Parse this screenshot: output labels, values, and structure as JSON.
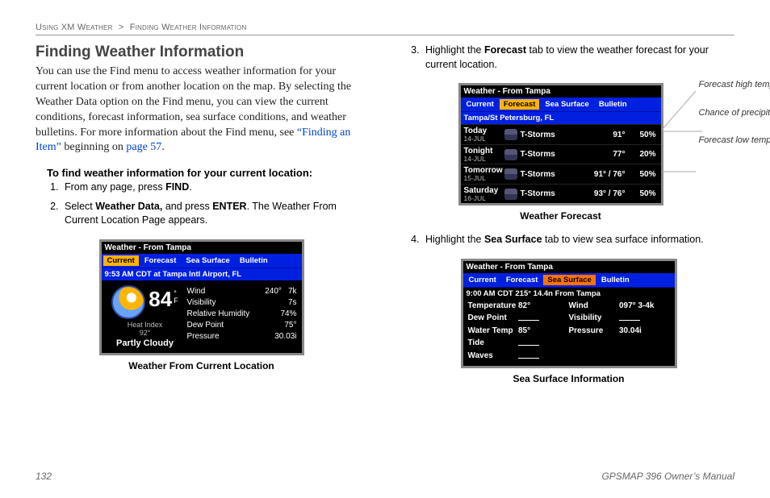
{
  "breadcrumb": {
    "section": "Using XM Weather",
    "sub": "Finding Weather Information"
  },
  "h1": "Finding Weather Information",
  "intro": {
    "text": "You can use the Find menu to access weather information for your current location or from another location on the map. By selecting the Weather Data option on the Find menu, you can view the current conditions, forecast information, sea surface conditions, and weather bulletins. For more information about the Find menu, see ",
    "link1": "“Finding an Item”",
    "mid": " beginning on ",
    "link2": "page 57",
    "end": "."
  },
  "sub_heading": "To find weather information for your current location:",
  "step1": {
    "a": "From any page, press ",
    "b": "FIND",
    "c": "."
  },
  "step2": {
    "a": "Select ",
    "b": "Weather Data,",
    "c": " and press ",
    "d": "ENTER",
    "e": ". The Weather From Current Location Page appears."
  },
  "step3": {
    "a": "Highlight the ",
    "b": "Forecast",
    "c": " tab to view the weather forecast for your current location."
  },
  "step4": {
    "a": "Highlight the ",
    "b": "Sea Surface",
    "c": " tab to view sea surface information."
  },
  "captions": {
    "current": "Weather From Current Location",
    "forecast": "Weather Forecast",
    "sea": "Sea Surface Information"
  },
  "callouts": {
    "hi": "Forecast high temperature",
    "precip": "Chance of precipitation",
    "lo": "Forecast low temperature"
  },
  "device_current": {
    "title": "Weather - From Tampa",
    "tabs": [
      "Current",
      "Forecast",
      "Sea Surface",
      "Bulletin"
    ],
    "active": 0,
    "subbar": "9:53 AM CDT at Tampa Intl Airport, FL",
    "temp": "84",
    "temp_unit_top": "°",
    "temp_unit_bot": "F",
    "heat_index_label": "Heat Index",
    "heat_index": "92°",
    "condition": "Partly Cloudy",
    "rows": [
      {
        "label": "Wind",
        "v1": "240°",
        "v2": "7k"
      },
      {
        "label": "Visibility",
        "v1": "",
        "v2": "7s"
      },
      {
        "label": "Relative Humidity",
        "v1": "",
        "v2": "74%"
      },
      {
        "label": "Dew Point",
        "v1": "",
        "v2": "75°"
      },
      {
        "label": "Pressure",
        "v1": "",
        "v2": "30.03i"
      }
    ]
  },
  "device_forecast": {
    "title": "Weather - From Tampa",
    "tabs": [
      "Current",
      "Forecast",
      "Sea Surface",
      "Bulletin"
    ],
    "active": 1,
    "subbar": "Tampa/St Petersburg, FL",
    "rows": [
      {
        "day": "Today",
        "date": "14-JUL",
        "cond": "T-Storms",
        "temp": "91°",
        "prec": "50%"
      },
      {
        "day": "Tonight",
        "date": "14-JUL",
        "cond": "T-Storms",
        "temp": "77°",
        "prec": "20%"
      },
      {
        "day": "Tomorrow",
        "date": "15-JUL",
        "cond": "T-Storms",
        "temp": "91° / 76°",
        "prec": "50%"
      },
      {
        "day": "Saturday",
        "date": "16-JUL",
        "cond": "T-Storms",
        "temp": "93° / 76°",
        "prec": "50%"
      }
    ]
  },
  "device_sea": {
    "title": "Weather - From Tampa",
    "tabs": [
      "Current",
      "Forecast",
      "Sea Surface",
      "Bulletin"
    ],
    "active": 2,
    "subbar": "9:00 AM CDT  215°  14.4n  From Tampa",
    "rows": [
      {
        "l1": "Temperature",
        "v1": "82°",
        "l2": "Wind",
        "v2": "097°  3-4k"
      },
      {
        "l1": "Dew Point",
        "v1": "__",
        "l2": "Visibility",
        "v2": "__"
      },
      {
        "l1": "Water Temp",
        "v1": "85°",
        "l2": "Pressure",
        "v2": "30.04i"
      },
      {
        "l1": "Tide",
        "v1": "__",
        "l2": "",
        "v2": ""
      },
      {
        "l1": "Waves",
        "v1": "__",
        "l2": "",
        "v2": ""
      }
    ]
  },
  "footer": {
    "page": "132",
    "manual": "GPSMAP 396 Owner’s Manual"
  }
}
